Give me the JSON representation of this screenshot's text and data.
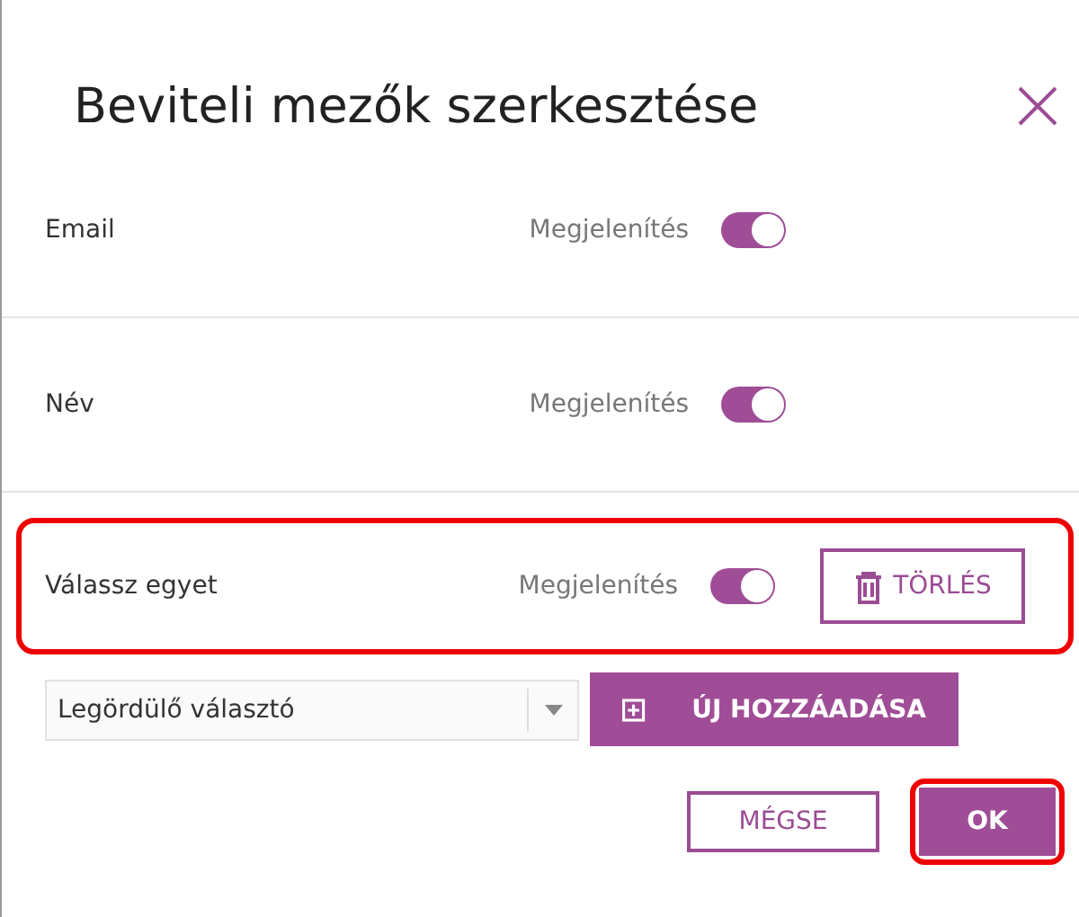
{
  "dialog": {
    "title": "Beviteli mezők szerkesztése"
  },
  "fields": [
    {
      "kind": "fixed",
      "label": "Email",
      "toggle_label": "Megjelenítés",
      "on": true,
      "highlighted": false
    },
    {
      "kind": "fixed",
      "label": "Név",
      "toggle_label": "Megjelenítés",
      "on": true,
      "highlighted": false
    },
    {
      "kind": "custom",
      "label": "Válassz egyet",
      "toggle_label": "Megjelenítés",
      "on": true,
      "highlighted": true,
      "delete_label": "TÖRLÉS"
    }
  ],
  "add_row": {
    "dropdown_value": "Legördülő választó",
    "add_label": "ÚJ HOZZÁADÁSA"
  },
  "buttons": [
    {
      "kind": "secondary",
      "label": "MÉGSE",
      "highlighted": false
    },
    {
      "kind": "primary",
      "label": "OK",
      "highlighted": true
    }
  ]
}
